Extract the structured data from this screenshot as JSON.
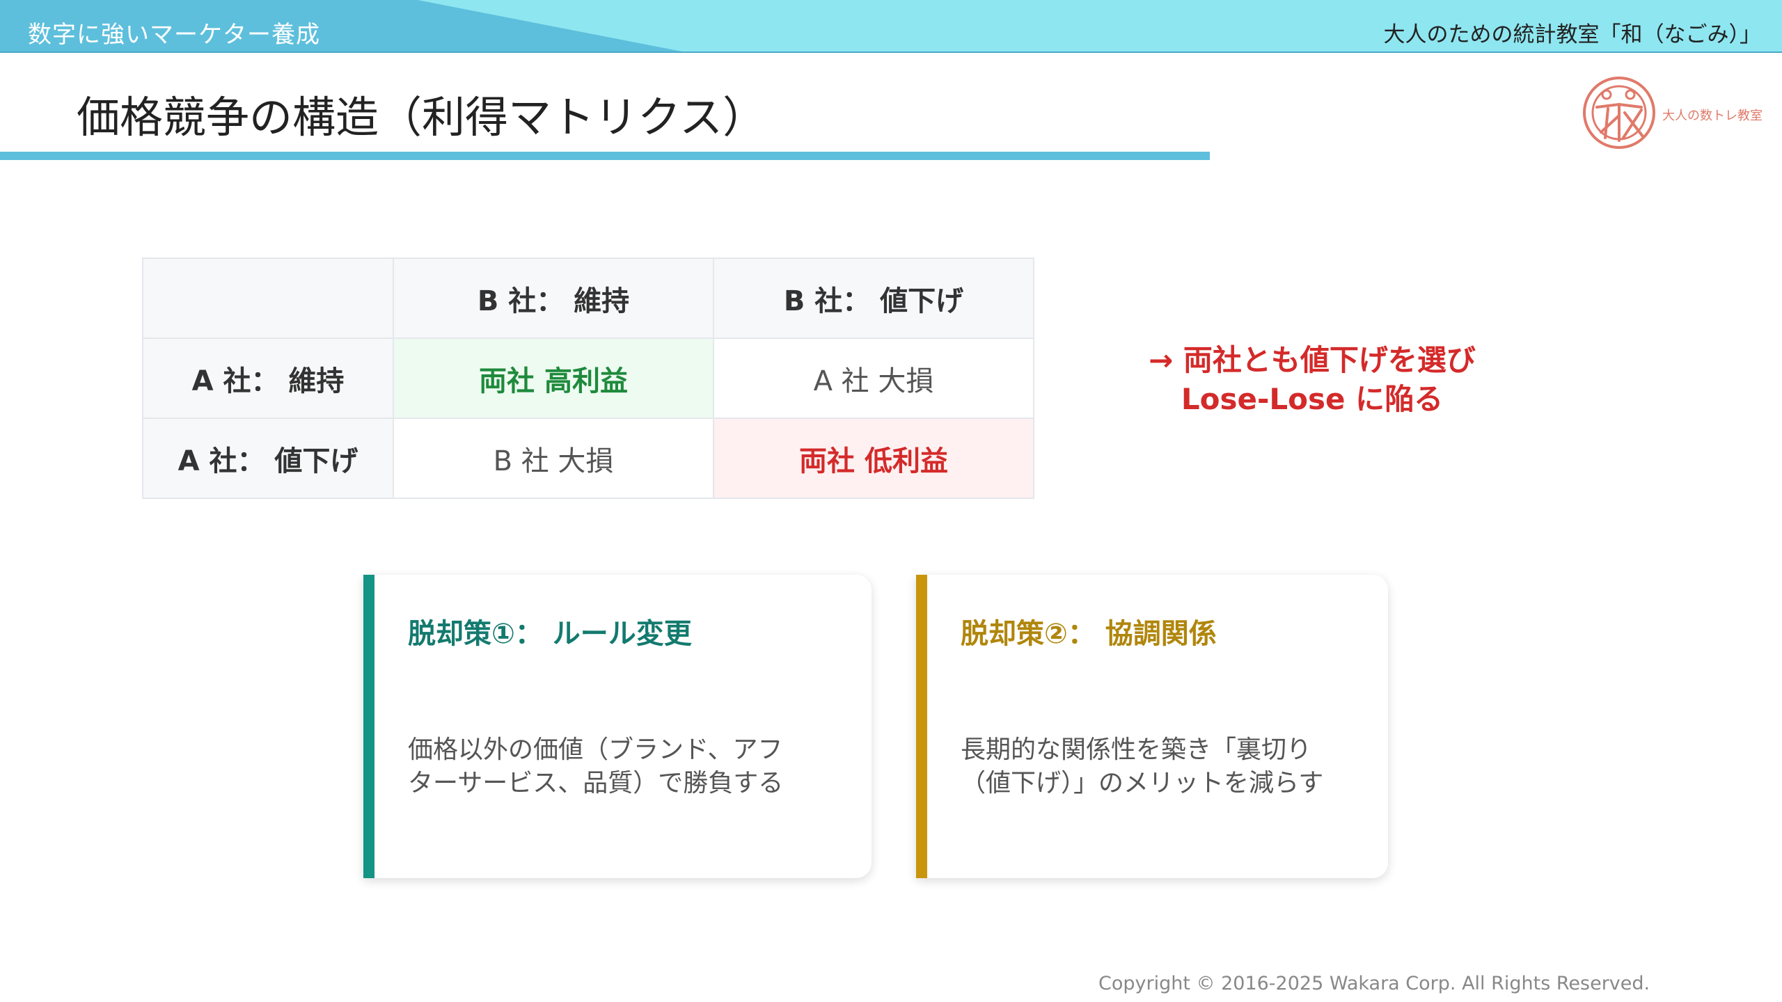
{
  "banner": {
    "left_text": "数字に強いマーケター養成",
    "right_text": "大人のための統計教室「和（なごみ）」"
  },
  "title": "価格競争の構造（利得マトリクス）",
  "logo": {
    "text": "大人の数トレ教室",
    "icon": "wakara-logo-icon",
    "color": "#e07a6a"
  },
  "matrix": {
    "col_headers": [
      "",
      "B 社： 維持",
      "B 社： 値下げ"
    ],
    "rows": [
      {
        "header": "A 社： 維持",
        "cells": [
          "両社 高利益",
          "A 社 大損"
        ]
      },
      {
        "header": "A 社： 値下げ",
        "cells": [
          "B 社 大損",
          "両社 低利益"
        ]
      }
    ]
  },
  "note": {
    "line1": "→ 両社とも値下げを選び",
    "line2": "Lose-Lose  に陥る",
    "color": "#d42a2a"
  },
  "cards": [
    {
      "title": "脱却策①： ルール変更",
      "body_lines": [
        "価格以外の価値（ブランド、アフ",
        "ターサービス、品質）で勝負する"
      ],
      "accent": "#149484"
    },
    {
      "title": "脱却策②： 協調関係",
      "body_lines": [
        "長期的な関係性を築き「裏切り",
        "（値下げ）」のメリットを減らす"
      ],
      "accent": "#c9950c"
    }
  ],
  "copyright": "Copyright © 2016-2025 Wakara Corp. All Rights Reserved."
}
